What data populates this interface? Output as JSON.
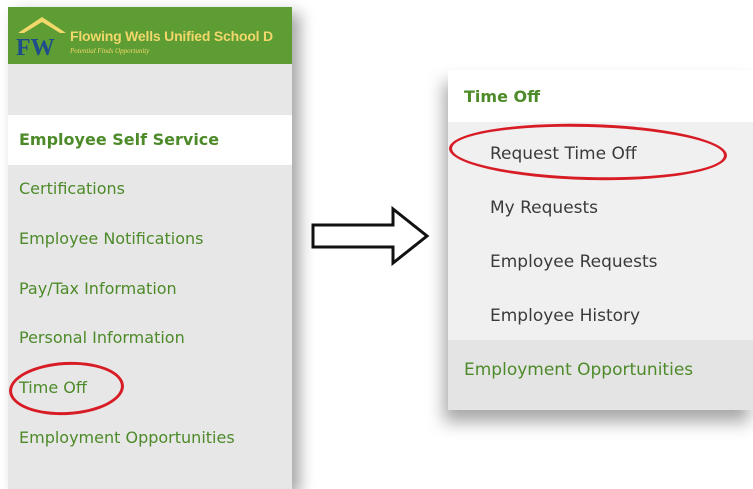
{
  "left_panel": {
    "district_name": "Flowing Wells Unified School D",
    "tagline": "Potential Finds Opportunity",
    "logo_text": "FW",
    "section_title": "Employee Self Service",
    "items": [
      {
        "label": "Certifications"
      },
      {
        "label": "Employee Notifications"
      },
      {
        "label": "Pay/Tax Information"
      },
      {
        "label": "Personal Information"
      },
      {
        "label": "Time Off"
      },
      {
        "label": "Employment Opportunities"
      }
    ]
  },
  "right_panel": {
    "title": "Time Off",
    "items": [
      {
        "label": "Request Time Off"
      },
      {
        "label": "My Requests"
      },
      {
        "label": "Employee Requests"
      },
      {
        "label": "Employee History"
      }
    ],
    "bottom_item": "Employment Opportunities"
  },
  "colors": {
    "brand_green": "#5d9d34",
    "menu_green": "#4d8a29",
    "highlight_red": "#d81c25",
    "logo_gold": "#f2d86a"
  },
  "icons": [
    "fw-logo-icon",
    "right-arrow-icon"
  ]
}
